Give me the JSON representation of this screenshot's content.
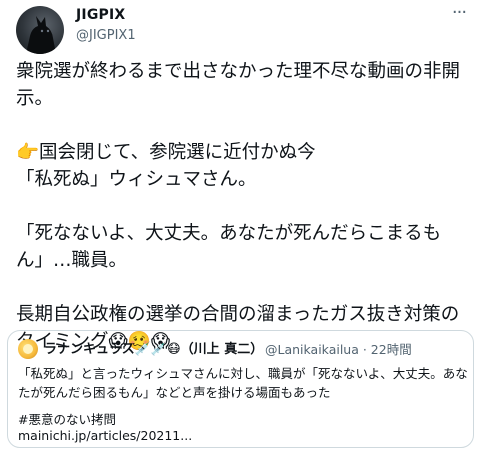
{
  "tweet": {
    "display_name": "JIGPIX",
    "handle": "@JIGPIX1",
    "more_glyph": "···",
    "body_text": "衆院選が終わるまで出さなかった理不尽な動画の非開示。\n\n👉国会閉じて、参院選に近付かぬ今\n「私死ぬ」ウィシュマさん。\n\n「死なないよ、大丈夫。あなたが死んだらこまるもん」…職員。\n\n長期自公政権の選挙の合間の溜まったガス抜き対策のタイミング😱🥴😱"
  },
  "quote": {
    "display_name": "ラナンキュラス💉💉😷（川上 真二）",
    "handle_time": "@Lanikaikailua · 22時間",
    "text": "「私死ぬ」と言ったウィシュマさんに対し、職員が「死なないよ、大丈夫。あなたが死んだら困るもん」などと声を掛ける場面もあった",
    "hashtag": "#悪意のない拷問",
    "link": "mainichi.jp/articles/20211..."
  },
  "icons": {
    "avatar": "dog-profile-icon",
    "quote_avatar": "sun-profile-icon",
    "more": "more-icon"
  }
}
